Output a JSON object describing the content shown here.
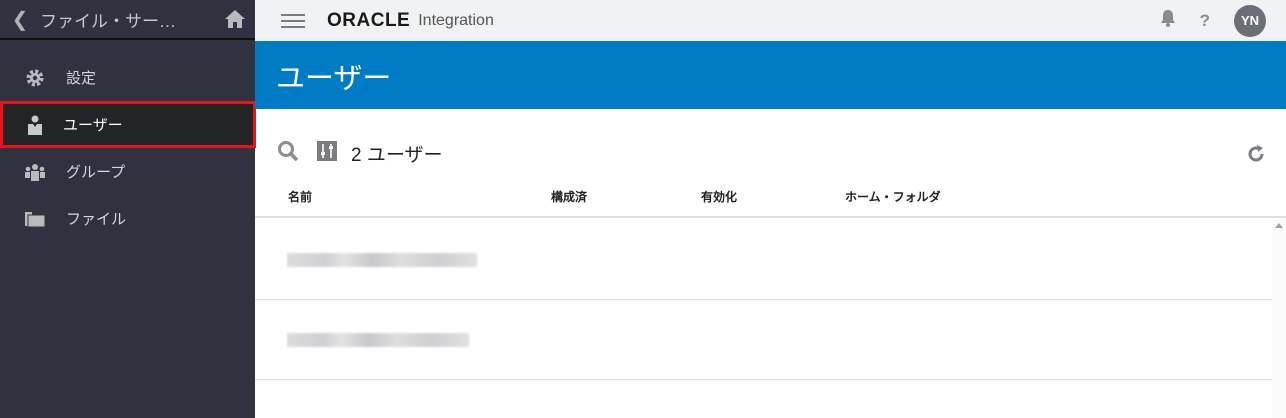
{
  "sidebar": {
    "title": "ファイル・サー…",
    "items": [
      {
        "label": "設定",
        "icon": "gear-icon"
      },
      {
        "label": "ユーザー",
        "icon": "user-icon",
        "active": true
      },
      {
        "label": "グループ",
        "icon": "group-icon"
      },
      {
        "label": "ファイル",
        "icon": "folder-icon"
      }
    ]
  },
  "topbar": {
    "brand": "ORACLE",
    "product": "Integration",
    "help": "?",
    "avatar": "YN"
  },
  "page": {
    "title": "ユーザー",
    "count_label": "2 ユーザー"
  },
  "table": {
    "columns": [
      "名前",
      "構成済",
      "有効化",
      "ホーム・フォルダ"
    ]
  },
  "colors": {
    "accent": "#007cc4",
    "sidebar": "#30323f",
    "highlight": "#e8141b"
  }
}
